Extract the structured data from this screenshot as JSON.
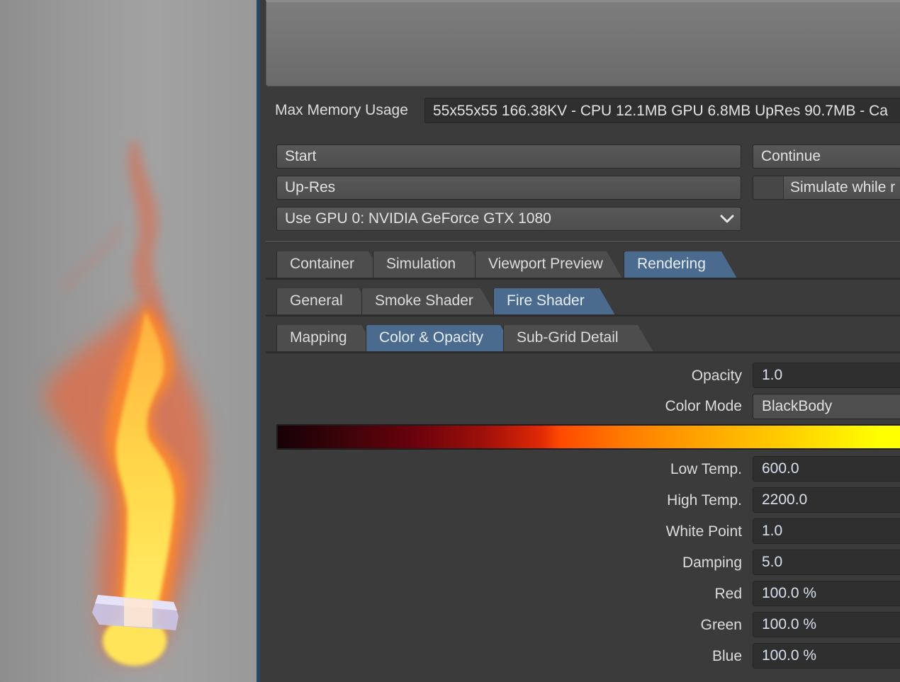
{
  "viewport": {
    "fire_icon": "fire-render",
    "object": "hex-emitter"
  },
  "memory": {
    "label": "Max Memory Usage",
    "value": "55x55x55 166.38KV - CPU 12.1MB GPU 6.8MB UpRes 90.7MB - Ca"
  },
  "buttons": {
    "start": "Start",
    "continue": "Continue",
    "upres": "Up-Res",
    "simulate_while": "Simulate while r",
    "gpu_select": "Use GPU 0: NVIDIA GeForce GTX 1080"
  },
  "tabs_main": [
    "Container",
    "Simulation",
    "Viewport Preview",
    "Rendering"
  ],
  "tabs_render": [
    "General",
    "Smoke Shader",
    "Fire Shader"
  ],
  "tabs_fire": [
    "Mapping",
    "Color & Opacity",
    "Sub-Grid Detail"
  ],
  "active_tabs": {
    "main": "Rendering",
    "render": "Fire Shader",
    "fire": "Color & Opacity"
  },
  "params": {
    "opacity": {
      "label": "Opacity",
      "value": "1.0"
    },
    "color_mode": {
      "label": "Color Mode",
      "value": "BlackBody"
    },
    "low_temp": {
      "label": "Low Temp.",
      "value": "600.0"
    },
    "high_temp": {
      "label": "High Temp.",
      "value": "2200.0"
    },
    "white_point": {
      "label": "White Point",
      "value": "1.0"
    },
    "damping": {
      "label": "Damping",
      "value": "5.0"
    },
    "red": {
      "label": "Red",
      "value": "100.0 %"
    },
    "green": {
      "label": "Green",
      "value": "100.0 %"
    },
    "blue": {
      "label": "Blue",
      "value": "100.0 %"
    }
  },
  "colors": {
    "accent_tab": "#4a6a8e",
    "panel_bg": "#3b3b3b",
    "field_bg": "#2f2f2f"
  }
}
